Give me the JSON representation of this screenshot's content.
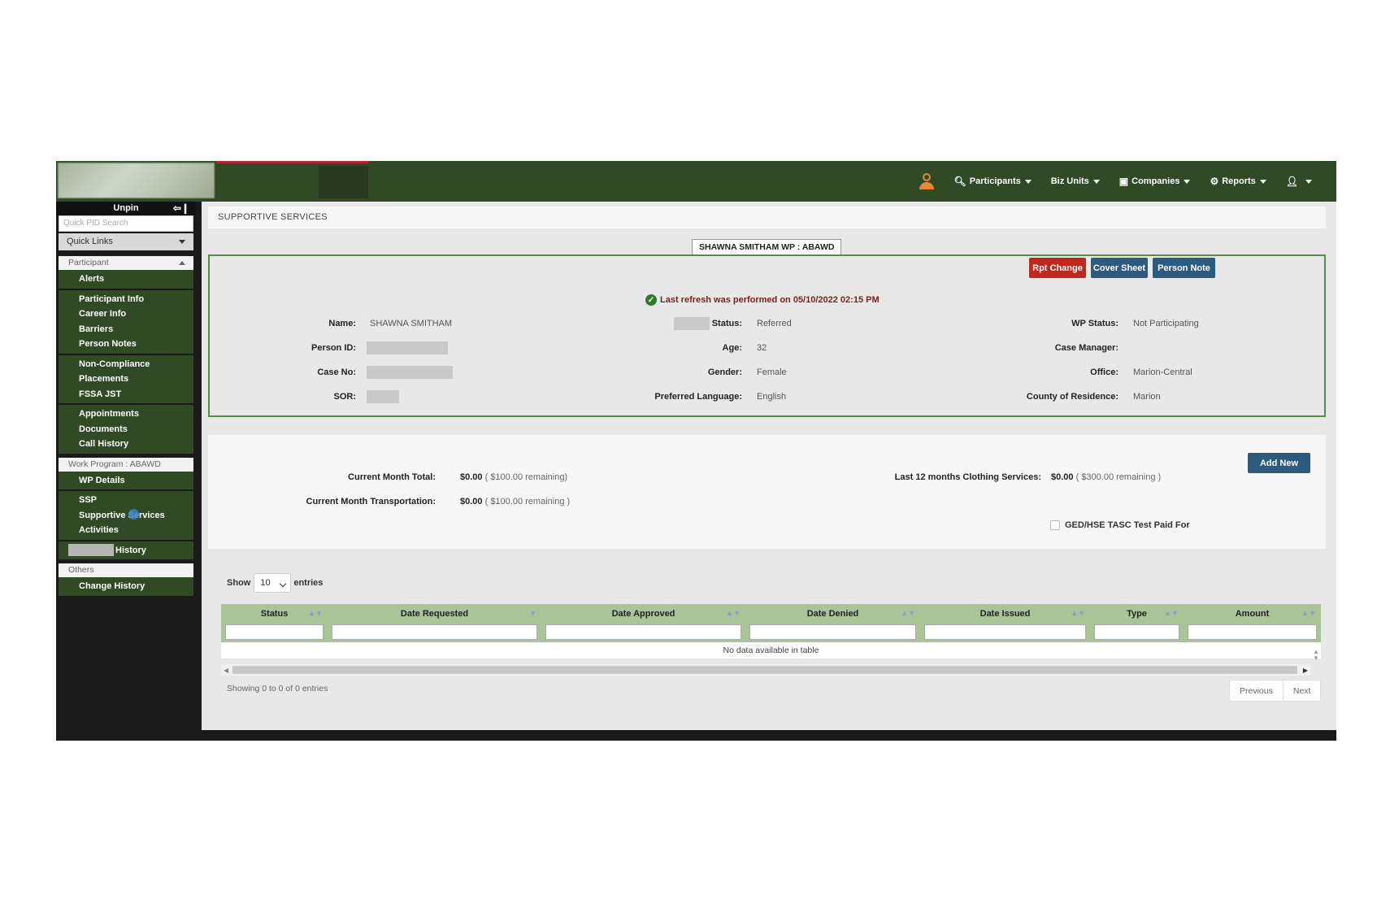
{
  "topbar": {
    "nav": [
      {
        "icon": "search-icon",
        "label": "Participants"
      },
      {
        "icon": "",
        "label": "Biz Units"
      },
      {
        "icon": "cube-icon",
        "label": "Companies"
      },
      {
        "icon": "gear-icon",
        "label": "Reports"
      },
      {
        "icon": "user-icon",
        "label": ""
      }
    ]
  },
  "sidebar": {
    "unpin_label": "Unpin",
    "search_placeholder": "Quick PID Search",
    "quick_links": "Quick Links",
    "participant_section": "Participant",
    "groups": [
      [
        "Alerts"
      ],
      [
        "Participant Info",
        "Career Info",
        "Barriers",
        "Person Notes"
      ],
      [
        "Non-Compliance",
        "Placements",
        "FSSA JST"
      ],
      [
        "Appointments",
        "Documents",
        "Call History"
      ]
    ],
    "work_program_section": "Work Program : ABAWD",
    "wp_groups": [
      [
        "WP Details"
      ],
      [
        "SSP",
        "Supportive Services",
        "Activities"
      ]
    ],
    "history_label": "History",
    "others_section": "Others",
    "others_items": [
      "Change History"
    ]
  },
  "page": {
    "title": "SUPPORTIVE SERVICES",
    "name_tab": "SHAWNA SMITHAM   WP : ABAWD",
    "buttons": {
      "rpt_change": "Rpt Change",
      "cover_sheet": "Cover Sheet",
      "person_note": "Person Note",
      "add_new": "Add New"
    },
    "refresh_text": "Last refresh was performed on 05/10/2022 02:15 PM"
  },
  "participant": {
    "name_label": "Name:",
    "name": "SHAWNA SMITHAM",
    "person_id_label": "Person ID:",
    "case_no_label": "Case No:",
    "sor_label": "SOR:",
    "status_label": "Status:",
    "status": "Referred",
    "age_label": "Age:",
    "age": "32",
    "gender_label": "Gender:",
    "gender": "Female",
    "language_label": "Preferred Language:",
    "language": "English",
    "wp_status_label": "WP Status:",
    "wp_status": "Not Participating",
    "case_manager_label": "Case Manager:",
    "office_label": "Office:",
    "office": "Marion-Central",
    "county_label": "County of Residence:",
    "county": "Marion"
  },
  "services": {
    "month_total_label": "Current Month Total:",
    "month_total_amount": "$0.00",
    "month_total_remaining": "( $100.00 remaining)",
    "transport_label": "Current Month Transportation:",
    "transport_amount": "$0.00",
    "transport_remaining": "( $100.00 remaining )",
    "clothing_label": "Last 12 months Clothing Services:",
    "clothing_amount": "$0.00",
    "clothing_remaining": "( $300.00 remaining )",
    "ged_label": "GED/HSE TASC Test Paid For"
  },
  "table": {
    "show_label": "Show",
    "entries_value": "10",
    "entries_label": "entries",
    "columns": [
      "Status",
      "Date Requested",
      "Date Approved",
      "Date Denied",
      "Date Issued",
      "Type",
      "Amount"
    ],
    "empty_text": "No data available in table",
    "showing_text": "Showing 0 to 0 of 0 entries",
    "previous": "Previous",
    "next": "Next"
  },
  "colors": {
    "topbar": "#2f4a24",
    "panel_border": "#5a8a48",
    "header_row": "#a9c497",
    "btn_red": "#c0281e",
    "btn_blue": "#2c5b7e"
  }
}
